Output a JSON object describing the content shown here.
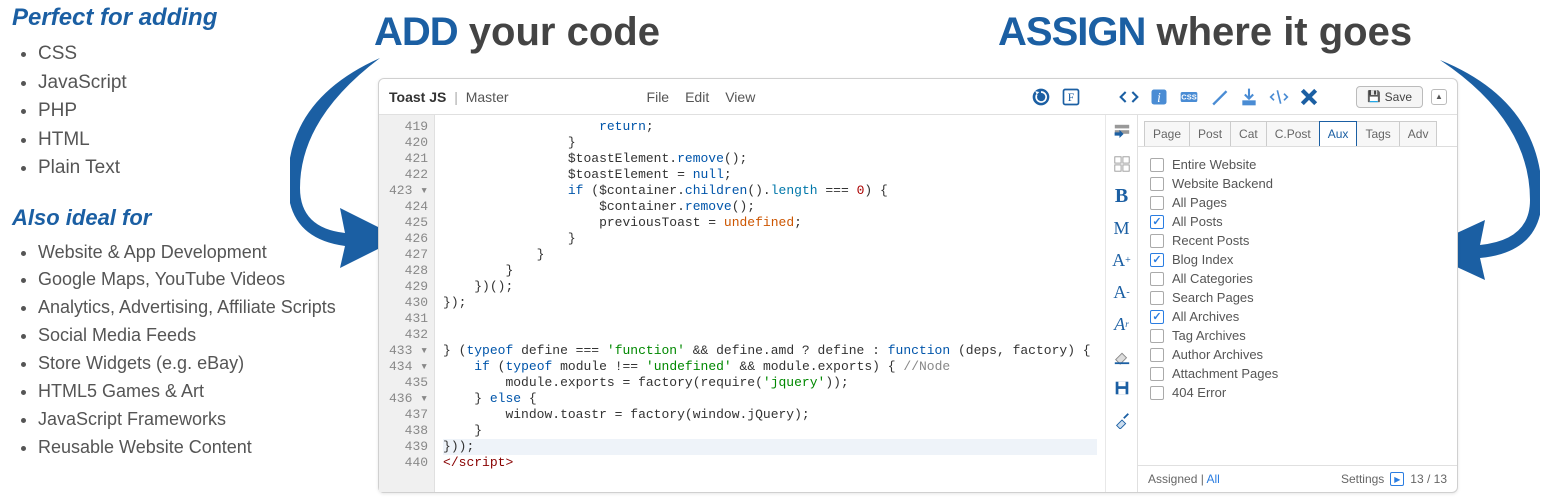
{
  "left": {
    "title1": "Perfect for adding",
    "list1": [
      "CSS",
      "JavaScript",
      "PHP",
      "HTML",
      "Plain Text"
    ],
    "title2": "Also ideal for",
    "list2": [
      "Website & App Development",
      "Google Maps, YouTube Videos",
      "Analytics, Advertising, Affiliate Scripts",
      "Social Media Feeds",
      "Store Widgets (e.g. eBay)",
      "HTML5 Games & Art",
      "JavaScript Frameworks",
      "Reusable Website Content"
    ]
  },
  "headings": {
    "add_bold": "ADD",
    "add_rest": " your code",
    "assign_bold": "ASSIGN",
    "assign_rest": " where it goes"
  },
  "editor": {
    "title_bold": "Toast JS",
    "title_sep": " | ",
    "title_rest": "Master",
    "menu": [
      "File",
      "Edit",
      "View"
    ],
    "save_label": "Save",
    "line_start": 419,
    "lines": [
      "                    <span class='kw'>return</span>;",
      "                }",
      "                $toastElement.<span class='fn'>remove</span>();",
      "                $toastElement = <span class='kw'>null</span>;",
      "                <span class='kw'>if</span> ($container.<span class='fn'>children</span>().<span class='id'>length</span> === <span class='num'>0</span>) {",
      "                    $container.<span class='fn'>remove</span>();",
      "                    previousToast = <span class='undef'>undefined</span>;",
      "                }",
      "            }",
      "        }",
      "    })();",
      "});",
      "",
      "",
      "} (<span class='kw'>typeof</span> define === <span class='str'>'function'</span> && define.amd ? define : <span class='kw'>function</span> (deps, factory) {",
      "    <span class='kw'>if</span> (<span class='kw'>typeof</span> module !== <span class='str'>'undefined'</span> && module.exports) { <span class='cmt'>//Node</span>",
      "        module.exports = factory(require(<span class='str'>'jquery'</span>));",
      "    } <span class='kw'>else</span> {",
      "        window.toastr = factory(window.jQuery);",
      "    }",
      "<span class='highlight-line'>}));</span>",
      "<span class='tag'>&lt;/script&gt;</span>"
    ],
    "fold_lines": [
      423,
      433,
      434,
      436
    ]
  },
  "assign": {
    "tabs": [
      {
        "label": "Page",
        "active": false
      },
      {
        "label": "Post",
        "active": false
      },
      {
        "label": "Cat",
        "active": false
      },
      {
        "label": "C.Post",
        "active": false
      },
      {
        "label": "Aux",
        "active": true
      },
      {
        "label": "Tags",
        "active": false
      },
      {
        "label": "Adv",
        "active": false
      }
    ],
    "items": [
      {
        "label": "Entire Website",
        "checked": false
      },
      {
        "label": "Website Backend",
        "checked": false
      },
      {
        "label": "All Pages",
        "checked": false
      },
      {
        "label": "All Posts",
        "checked": true
      },
      {
        "label": "Recent Posts",
        "checked": false
      },
      {
        "label": "Blog Index",
        "checked": true
      },
      {
        "label": "All Categories",
        "checked": false
      },
      {
        "label": "Search Pages",
        "checked": false
      },
      {
        "label": "All Archives",
        "checked": true
      },
      {
        "label": "Tag Archives",
        "checked": false
      },
      {
        "label": "Author Archives",
        "checked": false
      },
      {
        "label": "Attachment Pages",
        "checked": false
      },
      {
        "label": "404 Error",
        "checked": false
      }
    ],
    "footer_assigned": "Assigned",
    "footer_sep": " | ",
    "footer_all": "All",
    "footer_settings": "Settings",
    "footer_count": "13 / 13"
  }
}
